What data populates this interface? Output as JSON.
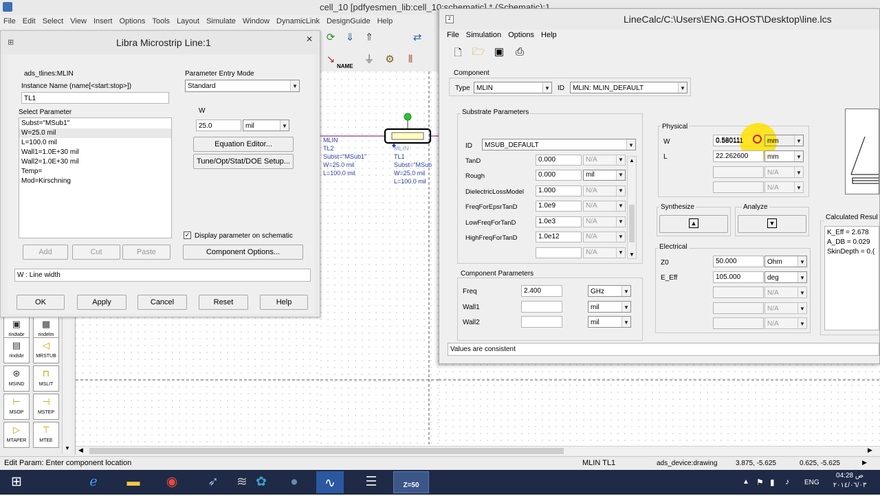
{
  "ads_window": {
    "title": "cell_10 [pdfyesmen_lib:cell_10:schematic] * (Schematic):1",
    "menu": [
      "File",
      "Edit",
      "Select",
      "View",
      "Insert",
      "Options",
      "Tools",
      "Layout",
      "Simulate",
      "Window",
      "DynamicLink",
      "DesignGuide",
      "Help"
    ],
    "status_left": "Edit Param: Enter component location",
    "status_mid": "MLIN TL1",
    "status_mode": "ads_device:drawing",
    "status_coord1": "3.875, -5.625",
    "status_coord2": "0.625, -5.625"
  },
  "schematic": {
    "tl2_name": "MLIN",
    "tl2_id": "TL2",
    "tl2_subst": "Subst=\"MSub1\"",
    "tl2_w": "W=25.0 mil",
    "tl2_l": "L=100.0 mil",
    "tl1_name": "MLIN",
    "tl1_id": "TL1",
    "tl1_subst": "Subst=\"MSub",
    "tl1_w": "W=25.0 mil",
    "tl1_l": "L=100.0 mil",
    "name_button": "NAME"
  },
  "palette": {
    "items": [
      {
        "label": "rindwbr",
        "icon": "▣"
      },
      {
        "label": "rindelm",
        "icon": "▦"
      },
      {
        "label": "rindsbr",
        "icon": "▤"
      },
      {
        "label": "MRSTUB",
        "icon": "◁"
      },
      {
        "label": "MSIND",
        "icon": "⊛"
      },
      {
        "label": "MSLIT",
        "icon": "⊓"
      },
      {
        "label": "MSOP",
        "icon": "⊢"
      },
      {
        "label": "MSTEP",
        "icon": "⊣"
      },
      {
        "label": "MTAPER",
        "icon": "▷"
      },
      {
        "label": "MTEE",
        "icon": "⊤"
      }
    ]
  },
  "libra": {
    "title": "Libra Microstrip Line:1",
    "component_name": "ads_tlines:MLIN",
    "instance_label": "Instance Name  (name[<start:stop>])",
    "instance_value": "TL1",
    "select_param_label": "Select Parameter",
    "params": [
      "Subst=\"MSub1\"",
      "W=25.0 mil",
      "L=100.0 mil",
      "Wall1=1.0E+30 mil",
      "Wall2=1.0E+30 mil",
      "Temp=",
      "Mod=Kirschning"
    ],
    "param_entry_label": "Parameter Entry Mode",
    "param_entry_value": "Standard",
    "w_label": "W",
    "w_value": "25.0",
    "w_unit": "mil",
    "equation_editor": "Equation Editor...",
    "tune_button": "Tune/Opt/Stat/DOE Setup...",
    "display_check_label": "Display parameter on schematic",
    "add": "Add",
    "cut": "Cut",
    "paste": "Paste",
    "component_options": "Component Options...",
    "description": "W : Line width",
    "ok": "OK",
    "apply": "Apply",
    "cancel": "Cancel",
    "reset": "Reset",
    "help": "Help"
  },
  "linecalc": {
    "title": "LineCalc/C:\\Users\\ENG.GHOST\\Desktop\\line.lcs",
    "menu": [
      "File",
      "Simulation",
      "Options",
      "Help"
    ],
    "component_group": "Component",
    "type_label": "Type",
    "type_value": "MLIN",
    "id_label": "ID",
    "id_value": "MLIN: MLIN_DEFAULT",
    "substrate_group": "Substrate Parameters",
    "sub_id_label": "ID",
    "sub_id_value": "MSUB_DEFAULT",
    "substrate_rows": [
      {
        "label": "TanD",
        "value": "0.000",
        "unit": "N/A"
      },
      {
        "label": "Rough",
        "value": "0.000",
        "unit": "mil"
      },
      {
        "label": "DielectricLossModel",
        "value": "1.000",
        "unit": "N/A"
      },
      {
        "label": "FreqForEpsrTanD",
        "value": "1.0e9",
        "unit": "N/A"
      },
      {
        "label": "LowFreqForTanD",
        "value": "1.0e3",
        "unit": "N/A"
      },
      {
        "label": "HighFreqForTanD",
        "value": "1.0e12",
        "unit": "N/A"
      },
      {
        "label": "",
        "value": "",
        "unit": "N/A"
      }
    ],
    "compparam_group": "Component Parameters",
    "freq_label": "Freq",
    "freq_value": "2.400",
    "freq_unit": "GHz",
    "wall1_label": "Wall1",
    "wall1_unit": "mil",
    "wall2_label": "Wall2",
    "wall2_unit": "mil",
    "physical_group": "Physical",
    "w_label": "W",
    "w_value": "0.580111",
    "w_unit": "mm",
    "l_label": "L",
    "l_value": "22.262600",
    "l_unit": "mm",
    "na": "N/A",
    "synthesize_label": "Synthesize",
    "analyze_label": "Analyze",
    "electrical_group": "Electrical",
    "z0_label": "Z0",
    "z0_value": "50.000",
    "z0_unit": "Ohm",
    "eeff_label": "E_Eff",
    "eeff_value": "105.000",
    "eeff_unit": "deg",
    "calc_group": "Calculated Resul",
    "calc_results": [
      "K_Eff = 2.678",
      "A_DB = 0.029",
      "SkinDepth = 0.("
    ],
    "status": "Values are consistent",
    "accent": "#ffe000"
  },
  "taskbar": {
    "lang": "ENG",
    "ampm": "ص",
    "time": "04:28",
    "date": "٢٠١٤/٠٦/٠٣",
    "zlabel": "Z=50"
  }
}
